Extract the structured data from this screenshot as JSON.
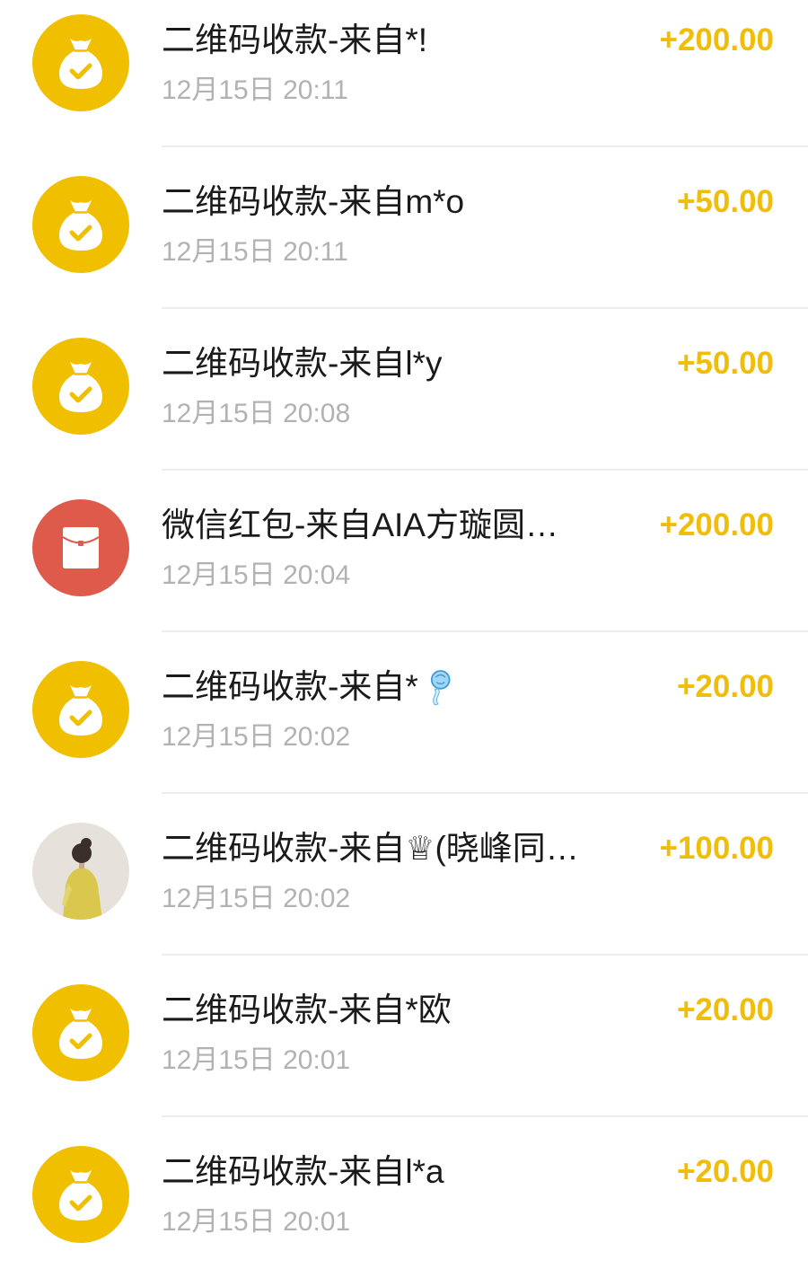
{
  "colors": {
    "background": "#FFFFFF",
    "primary_yellow": "#F0C000",
    "amount": "#F0BE0A",
    "red_packet": "#DE5A4A",
    "title_text": "#1A1A1A",
    "time_text": "#B2B2B2",
    "divider": "#EDEDED"
  },
  "transactions": [
    {
      "icon": "money-bag-check-icon",
      "title": "二维码收款-来自*!",
      "time": "12月15日 20:11",
      "amount": "+200.00"
    },
    {
      "icon": "money-bag-check-icon",
      "title": "二维码收款-来自m*o",
      "time": "12月15日 20:11",
      "amount": "+50.00"
    },
    {
      "icon": "money-bag-check-icon",
      "title": "二维码收款-来自l*y",
      "time": "12月15日 20:08",
      "amount": "+50.00"
    },
    {
      "icon": "red-packet-icon",
      "title": "微信红包-来自AIA方璇圆…",
      "time": "12月15日 20:04",
      "amount": "+200.00"
    },
    {
      "icon": "money-bag-check-icon",
      "title": "二维码收款-来自*",
      "title_emoji": "wind-chime-emoji-icon",
      "time": "12月15日 20:02",
      "amount": "+20.00"
    },
    {
      "icon": "user-avatar",
      "title": "二维码收款-来自♕(晓峰同…",
      "time": "12月15日 20:02",
      "amount": "+100.00"
    },
    {
      "icon": "money-bag-check-icon",
      "title": "二维码收款-来自*欧",
      "time": "12月15日 20:01",
      "amount": "+20.00"
    },
    {
      "icon": "money-bag-check-icon",
      "title": "二维码收款-来自l*a",
      "time": "12月15日 20:01",
      "amount": "+20.00"
    }
  ]
}
